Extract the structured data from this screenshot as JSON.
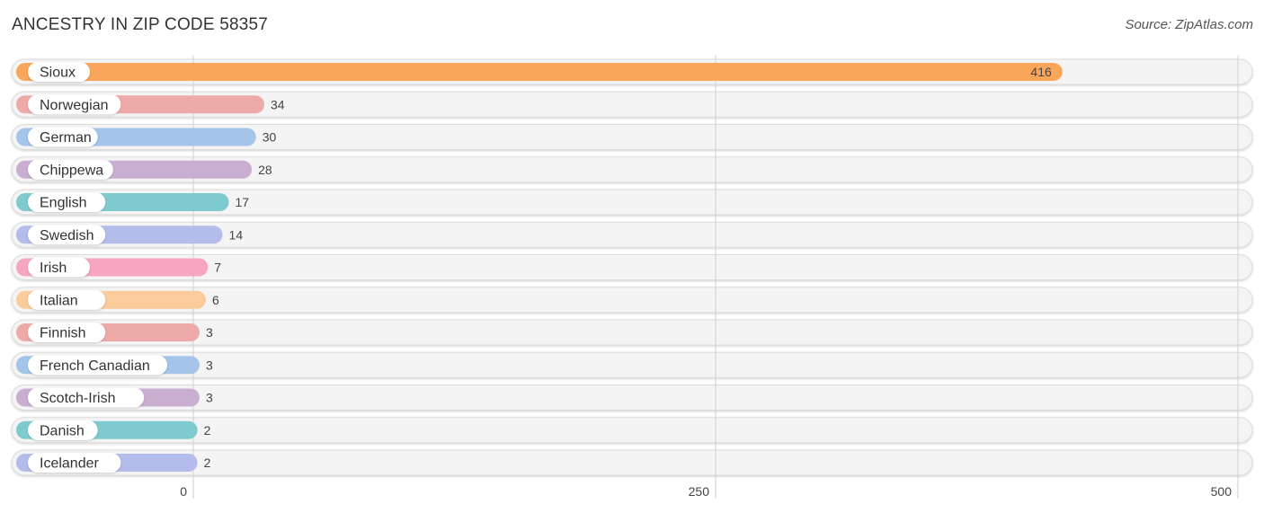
{
  "chart_data": {
    "type": "bar",
    "orientation": "horizontal",
    "title": "ANCESTRY IN ZIP CODE 58357",
    "source": "Source: ZipAtlas.com",
    "xlabel": "",
    "ylabel": "",
    "xlim": [
      0,
      500
    ],
    "ticks": [
      0,
      250,
      500
    ],
    "tick_labels": [
      "0",
      "250",
      "500"
    ],
    "grid": true,
    "categories": [
      "Sioux",
      "Norwegian",
      "German",
      "Chippewa",
      "English",
      "Swedish",
      "Irish",
      "Italian",
      "Finnish",
      "French Canadian",
      "Scotch-Irish",
      "Danish",
      "Icelander"
    ],
    "values": [
      416,
      34,
      30,
      28,
      17,
      14,
      7,
      6,
      3,
      3,
      3,
      2,
      2
    ],
    "value_labels": [
      "416",
      "34",
      "30",
      "28",
      "17",
      "14",
      "7",
      "6",
      "3",
      "3",
      "3",
      "2",
      "2"
    ],
    "colors": [
      "#f9a65a",
      "#eeaaa9",
      "#a4c4ea",
      "#c9aed2",
      "#7ecbcf",
      "#b3bcea",
      "#f7a6c1",
      "#fbcb9c",
      "#eeaaa9",
      "#a4c4ea",
      "#c9aed2",
      "#7ecbcf",
      "#b3bcea"
    ]
  }
}
